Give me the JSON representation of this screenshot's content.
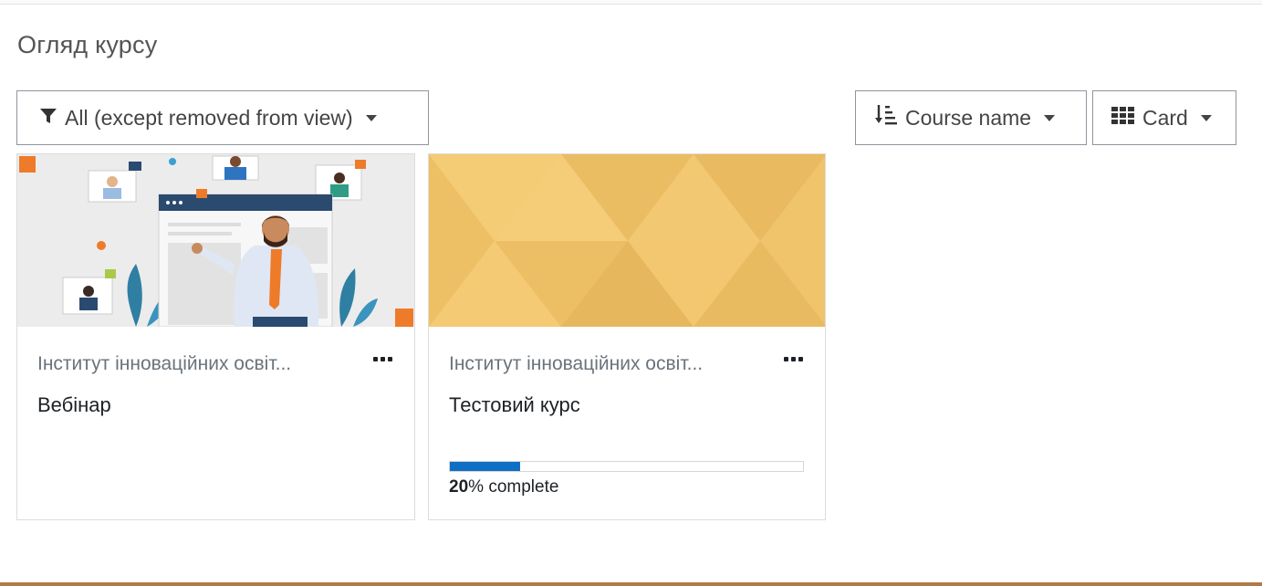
{
  "section": {
    "title": "Огляд курсу"
  },
  "controls": {
    "filter": {
      "label": "All (except removed from view)",
      "icon": "filter-icon"
    },
    "sort": {
      "label": "Course name",
      "icon": "sort-icon"
    },
    "view": {
      "label": "Card",
      "icon": "grid-icon"
    }
  },
  "courses": [
    {
      "category": "Інститут інноваційних освіт...",
      "name": "Вебінар",
      "image": "webinar-illustration"
    },
    {
      "category": "Інститут інноваційних освіт...",
      "name": "Тестовий курс",
      "image": "yellow-triangle-pattern",
      "progress": {
        "percent": 20,
        "value_text": "20",
        "suffix": "% complete"
      }
    }
  ],
  "colors": {
    "accent": "#0f6fc5",
    "pattern": "#f3c56a"
  }
}
